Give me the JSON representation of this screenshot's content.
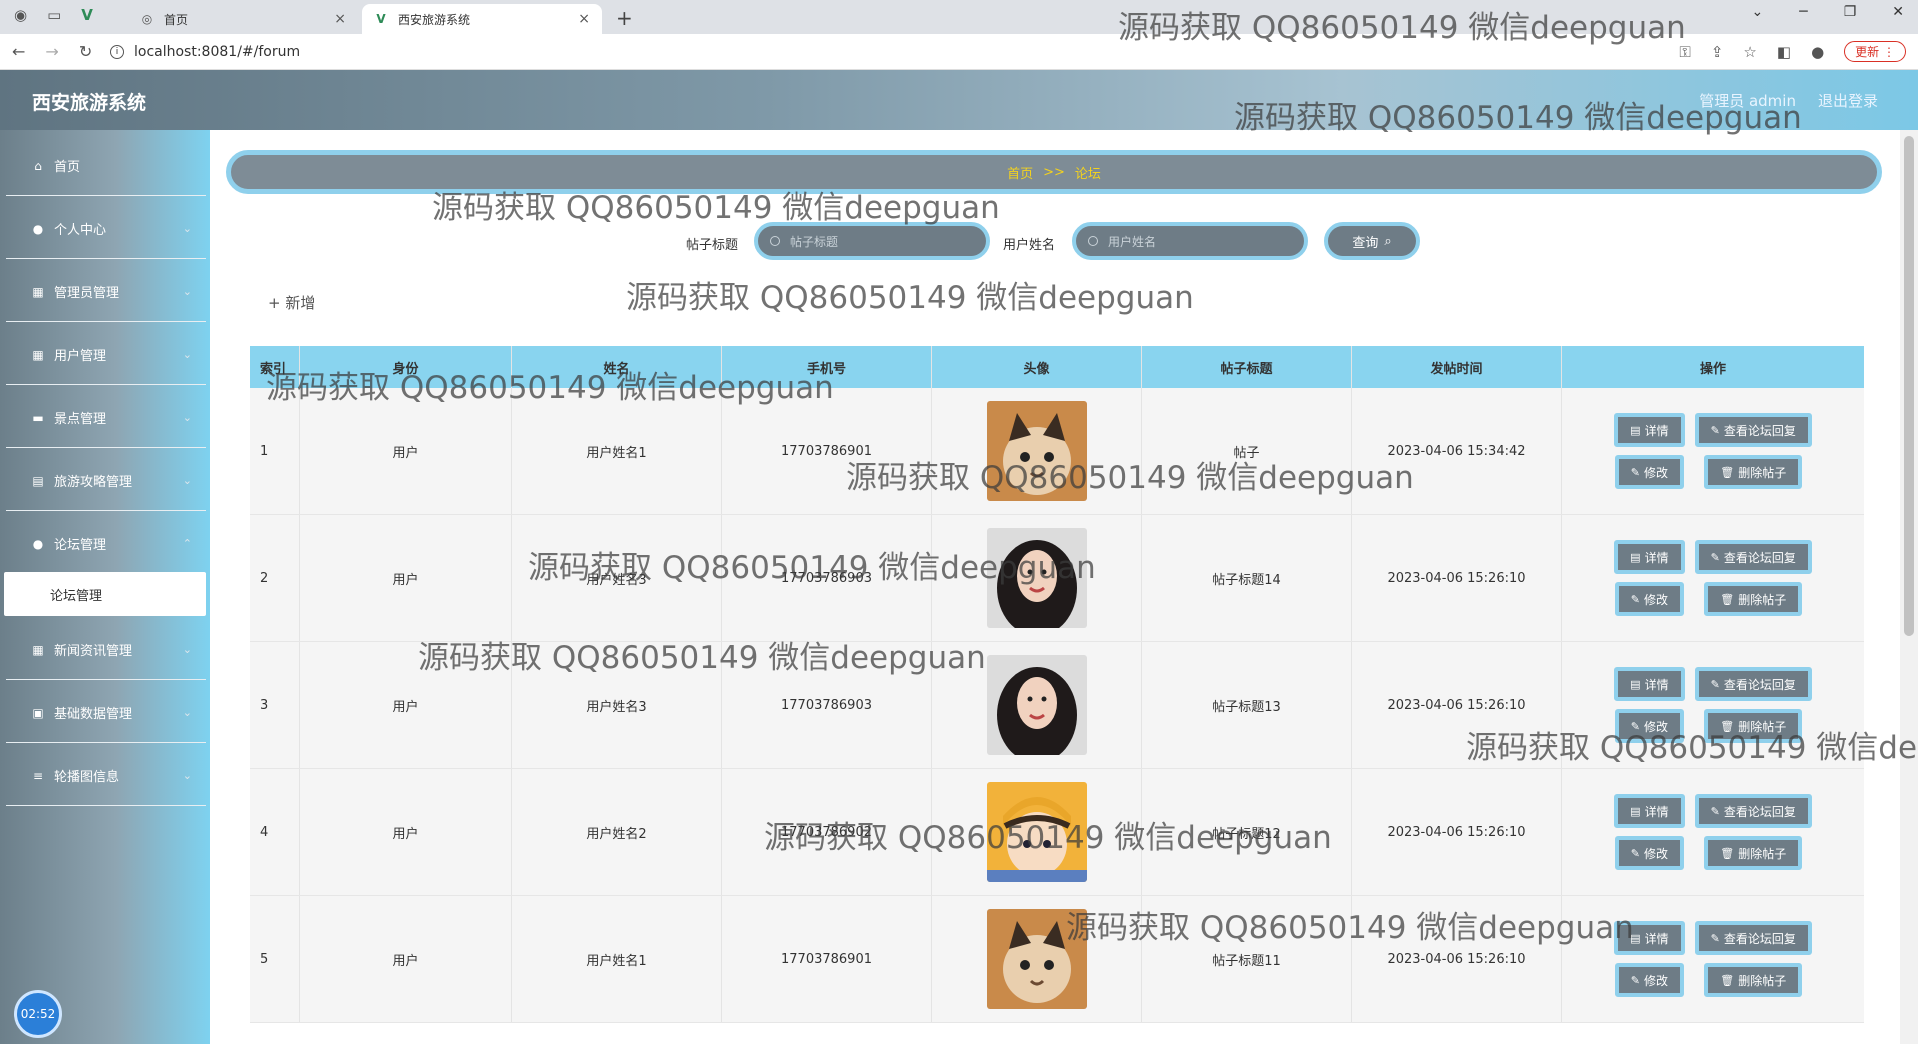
{
  "browser": {
    "tabs": [
      {
        "title": "首页"
      },
      {
        "title": "西安旅游系统"
      }
    ],
    "url": "localhost:8081/#/forum",
    "update_label": "更新"
  },
  "header": {
    "title": "西安旅游系统",
    "user": "管理员 admin",
    "logout": "退出登录"
  },
  "sidebar": {
    "items": [
      {
        "label": "首页",
        "icon": "home-icon"
      },
      {
        "label": "个人中心",
        "icon": "user-icon"
      },
      {
        "label": "管理员管理",
        "icon": "grid-icon"
      },
      {
        "label": "用户管理",
        "icon": "grid-icon"
      },
      {
        "label": "景点管理",
        "icon": "chat-icon"
      },
      {
        "label": "旅游攻略管理",
        "icon": "doc-icon"
      },
      {
        "label": "论坛管理",
        "icon": "user-icon"
      },
      {
        "label": "新闻资讯管理",
        "icon": "grid-icon"
      },
      {
        "label": "基础数据管理",
        "icon": "box-icon"
      },
      {
        "label": "轮播图信息",
        "icon": "list-icon"
      }
    ],
    "submenu": "论坛管理",
    "clock": "02:52"
  },
  "breadcrumb": {
    "home": "首页",
    "sep": ">>",
    "current": "论坛"
  },
  "search": {
    "title_label": "帖子标题",
    "title_placeholder": "帖子标题",
    "user_label": "用户姓名",
    "user_placeholder": "用户姓名",
    "button": "查询"
  },
  "add_button": "+ 新增",
  "table": {
    "headers": [
      "索引",
      "身份",
      "姓名",
      "手机号",
      "头像",
      "帖子标题",
      "发帖时间",
      "操作"
    ],
    "rows": [
      {
        "index": "1",
        "role": "用户",
        "name": "用户姓名1",
        "phone": "17703786901",
        "avatar": "cat",
        "title": "帖子",
        "time": "2023-04-06 15:34:42"
      },
      {
        "index": "2",
        "role": "用户",
        "name": "用户姓名3",
        "phone": "17703786903",
        "avatar": "woman",
        "title": "帖子标题14",
        "time": "2023-04-06 15:26:10"
      },
      {
        "index": "3",
        "role": "用户",
        "name": "用户姓名3",
        "phone": "17703786903",
        "avatar": "woman",
        "title": "帖子标题13",
        "time": "2023-04-06 15:26:10"
      },
      {
        "index": "4",
        "role": "用户",
        "name": "用户姓名2",
        "phone": "17703786902",
        "avatar": "boy",
        "title": "帖子标题12",
        "time": "2023-04-06 15:26:10"
      },
      {
        "index": "5",
        "role": "用户",
        "name": "用户姓名1",
        "phone": "17703786901",
        "avatar": "cat",
        "title": "帖子标题11",
        "time": "2023-04-06 15:26:10"
      }
    ],
    "ops": {
      "detail": "详情",
      "reply": "查看论坛回复",
      "edit": "修改",
      "delete": "删除帖子"
    }
  },
  "watermark": "源码获取 QQ86050149 微信deepguan",
  "colors": {
    "accent": "#8fd0ec",
    "button_bg": "#6e7c86",
    "breadcrumb_text": "#f3d21f"
  }
}
